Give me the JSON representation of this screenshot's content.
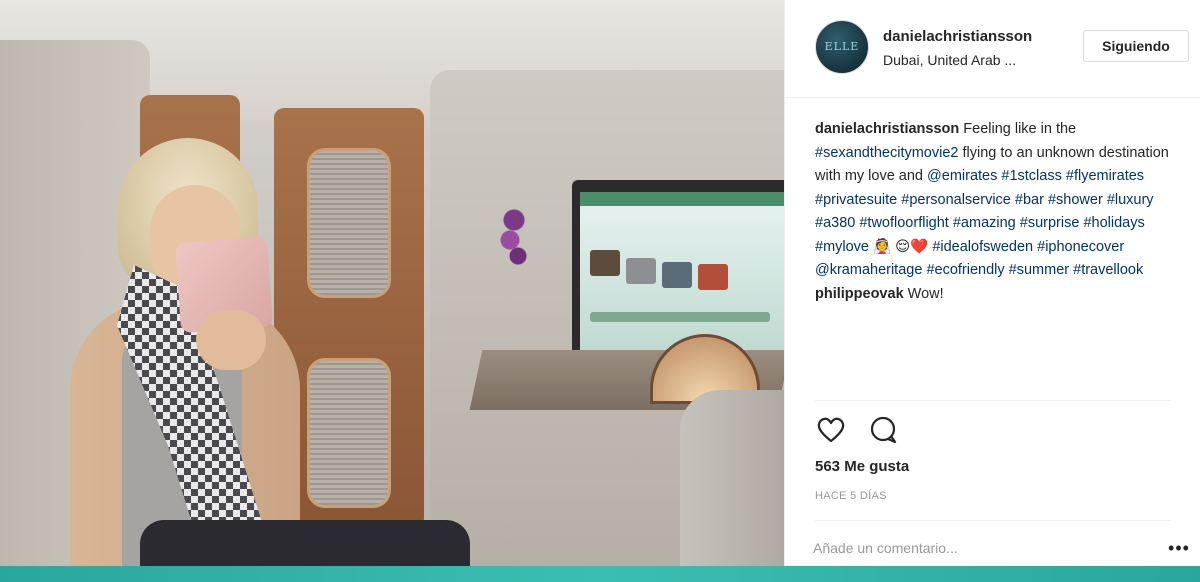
{
  "post": {
    "photo_alt": "",
    "header": {
      "avatar_text": "ELLE",
      "username": "danielachristiansson",
      "location": "Dubai, United Arab ...",
      "follow_label": "Siguiendo"
    },
    "caption": {
      "username": "danielachristiansson",
      "text_parts": [
        {
          "t": " Feeling like in the ",
          "tag": false
        },
        {
          "t": "#sexandthecitymovie2",
          "tag": true
        },
        {
          "t": " flying to an unknown destination with my love and ",
          "tag": false
        },
        {
          "t": "@emirates",
          "tag": true
        },
        {
          "t": " ",
          "tag": false
        },
        {
          "t": "#1stclass",
          "tag": true
        },
        {
          "t": " ",
          "tag": false
        },
        {
          "t": "#flyemirates",
          "tag": true
        },
        {
          "t": " ",
          "tag": false
        },
        {
          "t": "#privatesuite",
          "tag": true
        },
        {
          "t": " ",
          "tag": false
        },
        {
          "t": "#personalservice",
          "tag": true
        },
        {
          "t": " ",
          "tag": false
        },
        {
          "t": "#bar",
          "tag": true
        },
        {
          "t": " ",
          "tag": false
        },
        {
          "t": "#shower",
          "tag": true
        },
        {
          "t": " ",
          "tag": false
        },
        {
          "t": "#luxury",
          "tag": true
        },
        {
          "t": " ",
          "tag": false
        },
        {
          "t": "#a380",
          "tag": true
        },
        {
          "t": " ",
          "tag": false
        },
        {
          "t": "#twofloorflight",
          "tag": true
        },
        {
          "t": " ",
          "tag": false
        },
        {
          "t": "#amazing",
          "tag": true
        },
        {
          "t": " ",
          "tag": false
        },
        {
          "t": "#surprise",
          "tag": true
        },
        {
          "t": " ",
          "tag": false
        },
        {
          "t": "#holidays",
          "tag": true
        },
        {
          "t": " ",
          "tag": false
        },
        {
          "t": "#mylove",
          "tag": true
        },
        {
          "t": " 👰 😌❤️ ",
          "tag": false
        },
        {
          "t": "#idealofsweden",
          "tag": true
        },
        {
          "t": " ",
          "tag": false
        },
        {
          "t": "#iphonecover",
          "tag": true
        },
        {
          "t": " ",
          "tag": false
        },
        {
          "t": "@kramaheritage",
          "tag": true
        },
        {
          "t": " ",
          "tag": false
        },
        {
          "t": "#ecofriendly",
          "tag": true
        },
        {
          "t": " ",
          "tag": false
        },
        {
          "t": "#summer",
          "tag": true
        },
        {
          "t": " ",
          "tag": false
        },
        {
          "t": "#travellook",
          "tag": true
        }
      ]
    },
    "comments": [
      {
        "username": "philippeovak",
        "text": " Wow!"
      }
    ],
    "likes": "563 Me gusta",
    "time": "HACE 5 DÍAS",
    "comment_placeholder": "Añade un comentario...",
    "more_label": "•••",
    "icons": {
      "like": "heart-icon",
      "comment": "comment-bubble-icon"
    },
    "colors": {
      "link": "#003569",
      "text": "#262626",
      "muted": "#999999",
      "accent_bar": "#2aa79d"
    }
  }
}
